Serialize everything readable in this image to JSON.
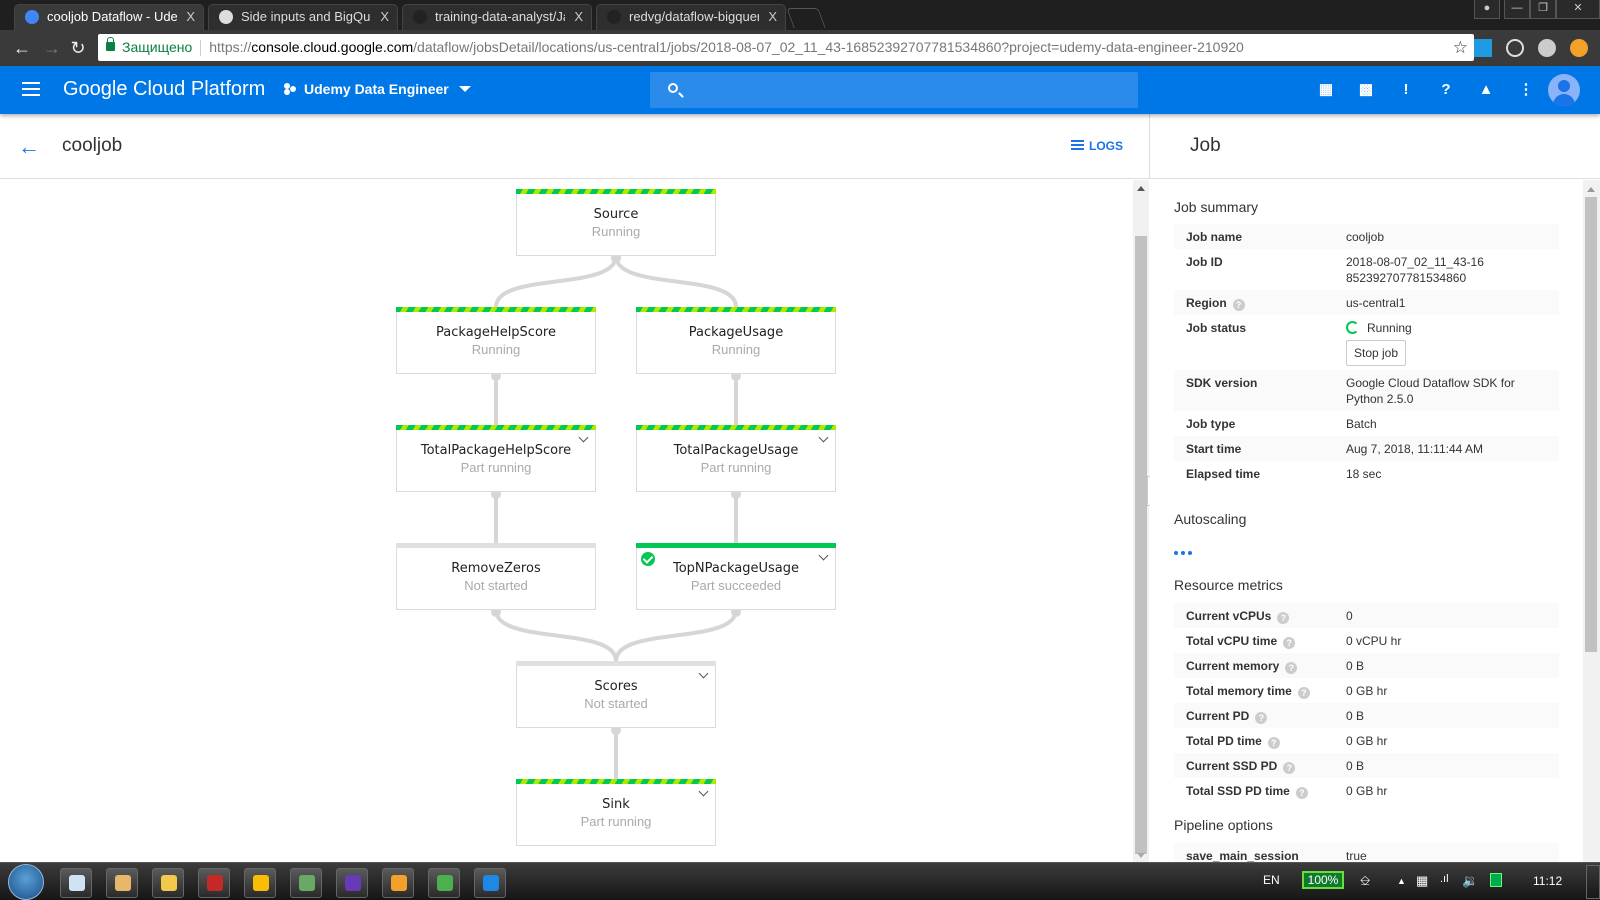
{
  "browser": {
    "tabs": [
      {
        "label": "cooljob Dataflow - Udemy",
        "active": true,
        "icon": "dataflow-icon"
      },
      {
        "label": "Side inputs and BigQuery",
        "active": false,
        "icon": "globe-icon"
      },
      {
        "label": "training-data-analyst/Java",
        "active": false,
        "icon": "github-icon"
      },
      {
        "label": "redvg/dataflow-bigquery",
        "active": false,
        "icon": "github-icon"
      }
    ],
    "tab_close": "X",
    "secure_label": "Защищено",
    "url_scheme": "https://",
    "url_host": "console.cloud.google.com",
    "url_path": "/dataflow/jobsDetail/locations/us-central1/jobs/2018-08-07_02_11_43-16852392707781534860?project=udemy-data-engineer-210920",
    "bookmark_icon": "☆"
  },
  "gcp": {
    "brand": "Google Cloud Platform",
    "project": "Udemy Data Engineer",
    "search_placeholder": ""
  },
  "page": {
    "title": "cooljob",
    "logs_label": "LOGS",
    "panel_title": "Job"
  },
  "graph": {
    "nodes": [
      {
        "id": "source",
        "name": "Source",
        "status": "Running",
        "state": "running",
        "expandable": false
      },
      {
        "id": "packagehelpscore",
        "name": "PackageHelpScore",
        "status": "Running",
        "state": "running",
        "expandable": false
      },
      {
        "id": "packageusage",
        "name": "PackageUsage",
        "status": "Running",
        "state": "running",
        "expandable": false
      },
      {
        "id": "totalpackagehelpscore",
        "name": "TotalPackageHelpScore",
        "status": "Part running",
        "state": "running",
        "expandable": true
      },
      {
        "id": "totalpackageusage",
        "name": "TotalPackageUsage",
        "status": "Part running",
        "state": "running",
        "expandable": true
      },
      {
        "id": "removezeros",
        "name": "RemoveZeros",
        "status": "Not started",
        "state": "notstarted",
        "expandable": false
      },
      {
        "id": "topnpackageusage",
        "name": "TopNPackageUsage",
        "status": "Part succeeded",
        "state": "succeeded",
        "expandable": true
      },
      {
        "id": "scores",
        "name": "Scores",
        "status": "Not started",
        "state": "notstarted",
        "expandable": true
      },
      {
        "id": "sink",
        "name": "Sink",
        "status": "Part running",
        "state": "running",
        "expandable": true
      }
    ],
    "edges": [
      [
        "source",
        "packagehelpscore"
      ],
      [
        "source",
        "packageusage"
      ],
      [
        "packagehelpscore",
        "totalpackagehelpscore"
      ],
      [
        "packageusage",
        "totalpackageusage"
      ],
      [
        "totalpackagehelpscore",
        "removezeros"
      ],
      [
        "totalpackageusage",
        "topnpackageusage"
      ],
      [
        "removezeros",
        "scores"
      ],
      [
        "topnpackageusage",
        "scores"
      ],
      [
        "scores",
        "sink"
      ]
    ]
  },
  "job_summary": {
    "heading": "Job summary",
    "rows": [
      {
        "key": "Job name",
        "value": "cooljob"
      },
      {
        "key": "Job ID",
        "value": "2018-08-07_02_11_43-16852392707781534860"
      },
      {
        "key": "Region",
        "value": "us-central1",
        "help": true
      },
      {
        "key": "Job status",
        "value": "Running",
        "status": true
      },
      {
        "key": "SDK version",
        "value": "Google Cloud Dataflow SDK for Python 2.5.0"
      },
      {
        "key": "Job type",
        "value": "Batch"
      },
      {
        "key": "Start time",
        "value": "Aug 7, 2018, 11:11:44 AM"
      },
      {
        "key": "Elapsed time",
        "value": "18 sec"
      }
    ],
    "stop_label": "Stop job"
  },
  "autoscaling": {
    "heading": "Autoscaling"
  },
  "resource_metrics": {
    "heading": "Resource metrics",
    "rows": [
      {
        "key": "Current vCPUs",
        "value": "0"
      },
      {
        "key": "Total vCPU time",
        "value": "0 vCPU hr"
      },
      {
        "key": "Current memory",
        "value": "0 B"
      },
      {
        "key": "Total memory time",
        "value": "0 GB hr"
      },
      {
        "key": "Current PD",
        "value": "0 B"
      },
      {
        "key": "Total PD time",
        "value": "0 GB hr"
      },
      {
        "key": "Current SSD PD",
        "value": "0 B"
      },
      {
        "key": "Total SSD PD time",
        "value": "0 GB hr"
      }
    ]
  },
  "pipeline_options": {
    "heading": "Pipeline options",
    "rows": [
      {
        "key": "save_main_session",
        "value": "true"
      }
    ]
  },
  "taskbar": {
    "apps": [
      "notepad-icon",
      "paint-icon",
      "explorer-icon",
      "acrobat-icon",
      "chrome-icon",
      "task-manager-icon",
      "obs-icon",
      "chrome-canary-icon",
      "atom-icon",
      "vscode-icon"
    ],
    "language": "EN",
    "battery": "100%",
    "clock": "11:12"
  }
}
